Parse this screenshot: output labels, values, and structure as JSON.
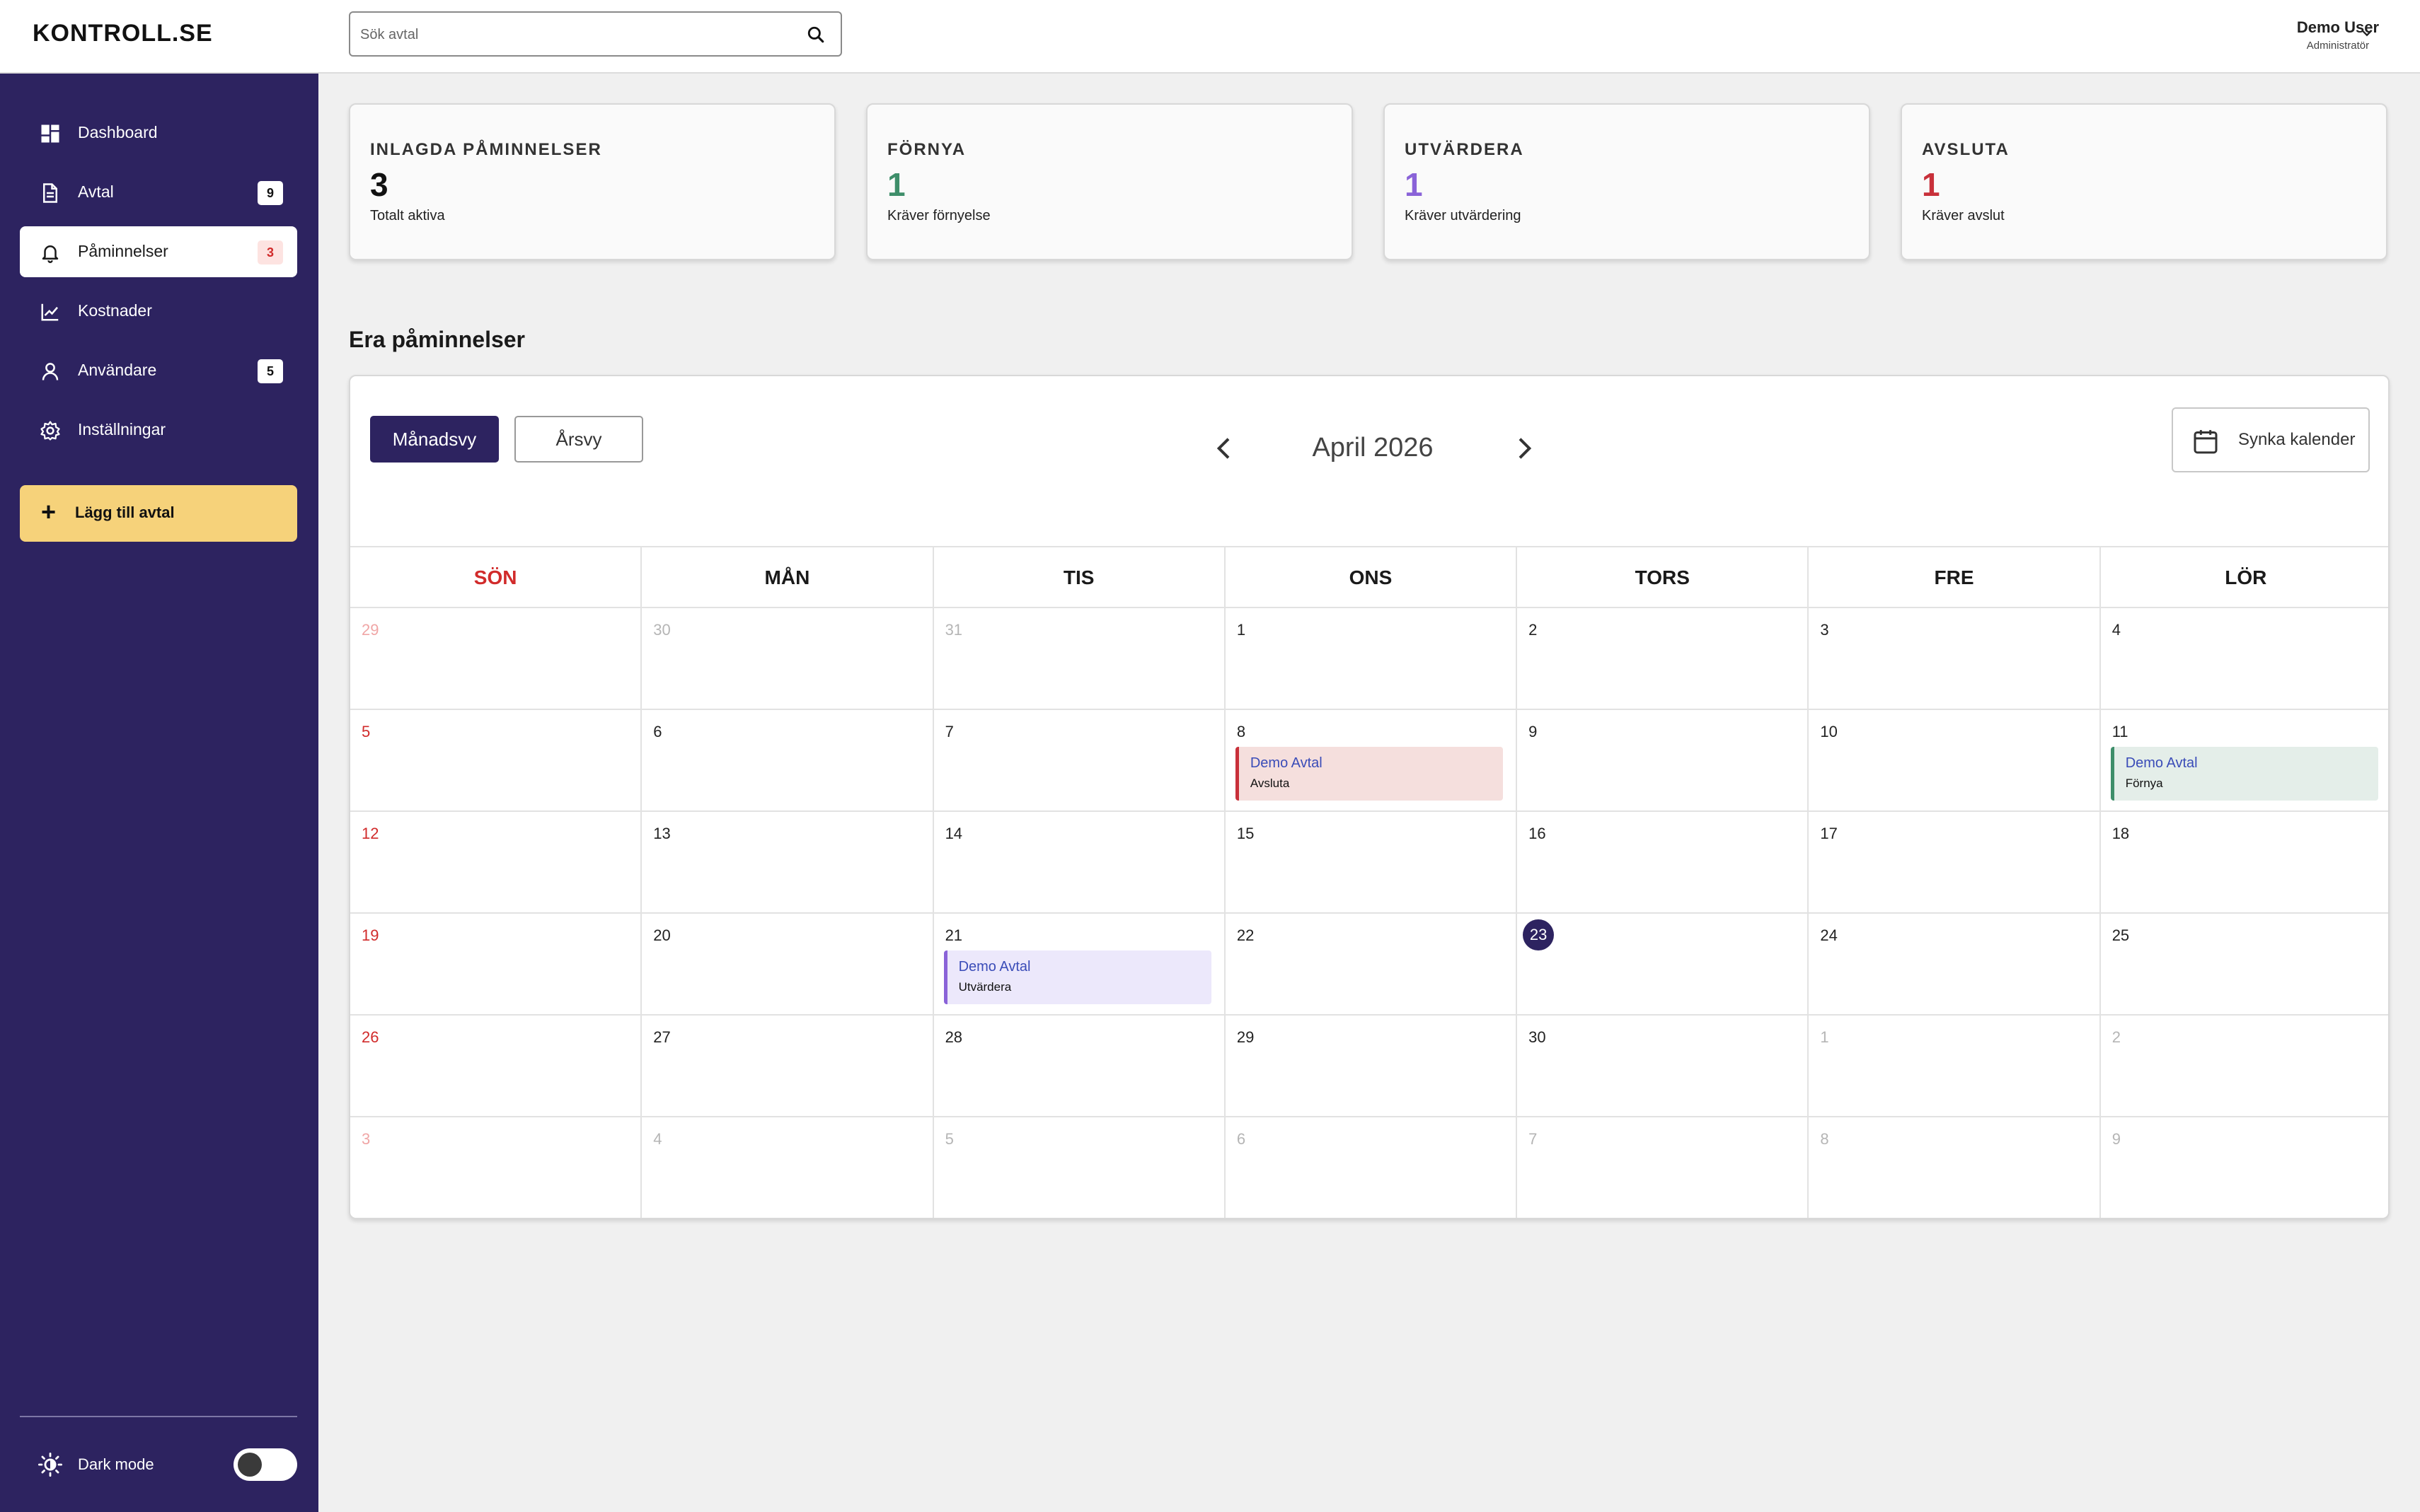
{
  "app": {
    "logo": "KONTROLL.SE"
  },
  "search": {
    "placeholder": "Sök avtal"
  },
  "user": {
    "name": "Demo User",
    "role": "Administratör"
  },
  "sidebar": {
    "items": [
      {
        "label": "Dashboard",
        "icon": "dashboard-icon",
        "badge": null
      },
      {
        "label": "Avtal",
        "icon": "document-icon",
        "badge": "9"
      },
      {
        "label": "Påminnelser",
        "icon": "bell-icon",
        "badge": "3",
        "active": true
      },
      {
        "label": "Kostnader",
        "icon": "chart-line-icon",
        "badge": null
      },
      {
        "label": "Användare",
        "icon": "user-icon",
        "badge": "5"
      },
      {
        "label": "Inställningar",
        "icon": "gear-icon",
        "badge": null
      }
    ],
    "add_button": "Lägg till avtal",
    "dark_mode_label": "Dark mode",
    "dark_mode_on": false
  },
  "cards": [
    {
      "title": "INLAGDA PÅMINNELSER",
      "value": "3",
      "subtitle": "Totalt aktiva",
      "color": "#111111"
    },
    {
      "title": "FÖRNYA",
      "value": "1",
      "subtitle": "Kräver förnyelse",
      "color": "#3e8e6a"
    },
    {
      "title": "UTVÄRDERA",
      "value": "1",
      "subtitle": "Kräver utvärdering",
      "color": "#8a63d8"
    },
    {
      "title": "AVSLUTA",
      "value": "1",
      "subtitle": "Kräver avslut",
      "color": "#c8303a"
    }
  ],
  "section_title": "Era påminnelser",
  "calendar": {
    "view_buttons": {
      "month": "Månadsvy",
      "year": "Årsvy"
    },
    "month_label": "April 2026",
    "sync_label": "Synka kalender",
    "weekdays": [
      "SÖN",
      "MÅN",
      "TIS",
      "ONS",
      "TORS",
      "FRE",
      "LÖR"
    ],
    "weeks": [
      [
        {
          "d": "29",
          "o": true
        },
        {
          "d": "30",
          "o": true
        },
        {
          "d": "31",
          "o": true
        },
        {
          "d": "1"
        },
        {
          "d": "2"
        },
        {
          "d": "3"
        },
        {
          "d": "4"
        }
      ],
      [
        {
          "d": "5"
        },
        {
          "d": "6"
        },
        {
          "d": "7"
        },
        {
          "d": "8",
          "event": {
            "title": "Demo Avtal",
            "type": "Avsluta",
            "kind": "avsluta"
          }
        },
        {
          "d": "9"
        },
        {
          "d": "10"
        },
        {
          "d": "11",
          "event": {
            "title": "Demo Avtal",
            "type": "Förnya",
            "kind": "fornya"
          }
        }
      ],
      [
        {
          "d": "12"
        },
        {
          "d": "13"
        },
        {
          "d": "14"
        },
        {
          "d": "15"
        },
        {
          "d": "16"
        },
        {
          "d": "17"
        },
        {
          "d": "18"
        }
      ],
      [
        {
          "d": "19"
        },
        {
          "d": "20"
        },
        {
          "d": "21",
          "event": {
            "title": "Demo Avtal",
            "type": "Utvärdera",
            "kind": "utvardera"
          }
        },
        {
          "d": "22"
        },
        {
          "d": "23",
          "today": true
        },
        {
          "d": "24"
        },
        {
          "d": "25"
        }
      ],
      [
        {
          "d": "26"
        },
        {
          "d": "27"
        },
        {
          "d": "28"
        },
        {
          "d": "29"
        },
        {
          "d": "30"
        },
        {
          "d": "1",
          "o": true
        },
        {
          "d": "2",
          "o": true
        }
      ],
      [
        {
          "d": "3",
          "o": true
        },
        {
          "d": "4",
          "o": true
        },
        {
          "d": "5",
          "o": true
        },
        {
          "d": "6",
          "o": true
        },
        {
          "d": "7",
          "o": true
        },
        {
          "d": "8",
          "o": true
        },
        {
          "d": "9",
          "o": true
        }
      ]
    ]
  }
}
